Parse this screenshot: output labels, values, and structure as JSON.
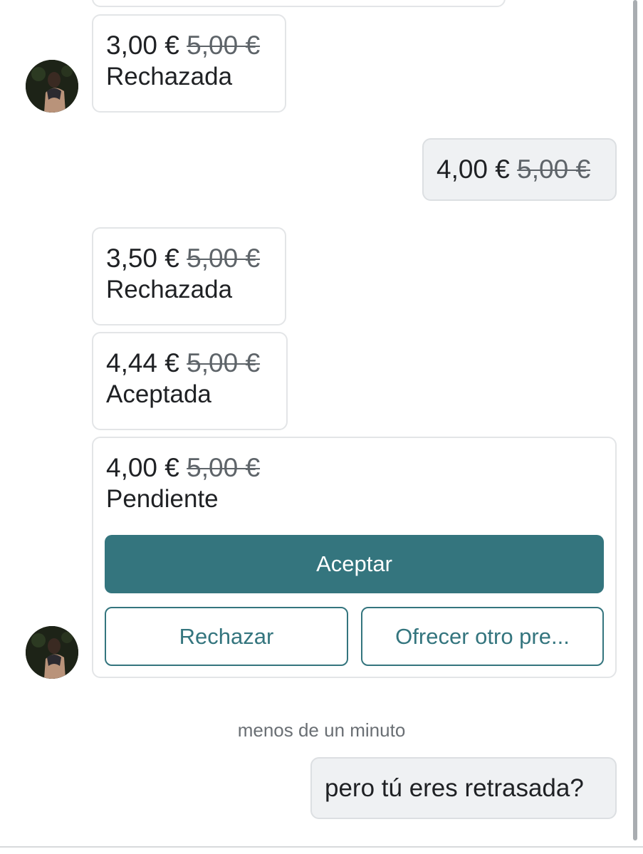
{
  "offers": [
    {
      "price": "3,00 €",
      "original": "5,00 €",
      "status": "Rechazada"
    },
    {
      "price": "4,00 €",
      "original": "5,00 €"
    },
    {
      "price": "3,50 €",
      "original": "5,00 €",
      "status": "Rechazada"
    },
    {
      "price": "4,44 €",
      "original": "5,00 €",
      "status": "Aceptada"
    },
    {
      "price": "4,00 €",
      "original": "5,00 €",
      "status": "Pendiente"
    }
  ],
  "actions": {
    "accept": "Aceptar",
    "reject": "Rechazar",
    "counter": "Ofrecer otro pre..."
  },
  "timestamp": "menos de un minuto",
  "last_message": "pero tú eres retrasada?",
  "colors": {
    "accent": "#34757e",
    "own_bubble": "#eff1f3"
  }
}
